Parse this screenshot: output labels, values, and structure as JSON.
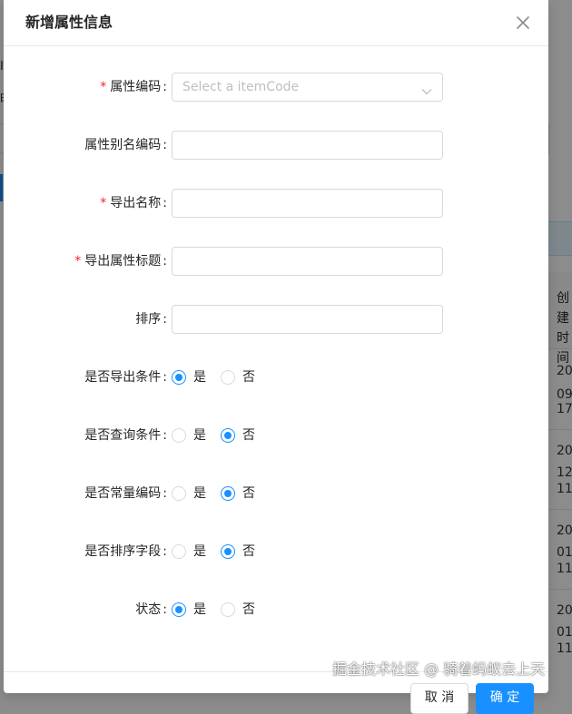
{
  "modal": {
    "title": "新增属性信息",
    "close_icon": "close-icon",
    "fields": {
      "item_code": {
        "label": "属性编码",
        "required": true,
        "placeholder": "Select a itemCode",
        "value": ""
      },
      "alias_code": {
        "label": "属性别名编码",
        "required": false,
        "value": ""
      },
      "export_name": {
        "label": "导出名称",
        "required": true,
        "value": ""
      },
      "export_title": {
        "label": "导出属性标题",
        "required": true,
        "value": ""
      },
      "sort": {
        "label": "排序",
        "required": false,
        "value": ""
      }
    },
    "radios": {
      "export_condition": {
        "label": "是否导出条件",
        "yes": "是",
        "no": "否",
        "selected": "是"
      },
      "query_condition": {
        "label": "是否查询条件",
        "yes": "是",
        "no": "否",
        "selected": "否"
      },
      "constant_code": {
        "label": "是否常量编码",
        "yes": "是",
        "no": "否",
        "selected": "否"
      },
      "sort_field": {
        "label": "是否排序字段",
        "yes": "是",
        "no": "否",
        "selected": "否"
      },
      "status": {
        "label": "状态",
        "yes": "是",
        "no": "否",
        "selected": "是"
      }
    },
    "required_mark": "*",
    "colon": ":",
    "footer": {
      "cancel_label": "取 消",
      "ok_label": "确 定"
    }
  },
  "background": {
    "column_header": "创建时间",
    "rows": [
      [
        "20",
        "09",
        "17"
      ],
      [
        "20",
        "12",
        "11"
      ],
      [
        "20",
        "01",
        "11"
      ],
      [
        "20",
        "01",
        "11"
      ]
    ]
  },
  "watermark": "掘金技术社区 @ 骑着蚂蚁去上天",
  "colors": {
    "primary": "#1890ff",
    "required": "#f5222d",
    "border": "#d9d9d9",
    "placeholder": "#bfbfbf"
  }
}
